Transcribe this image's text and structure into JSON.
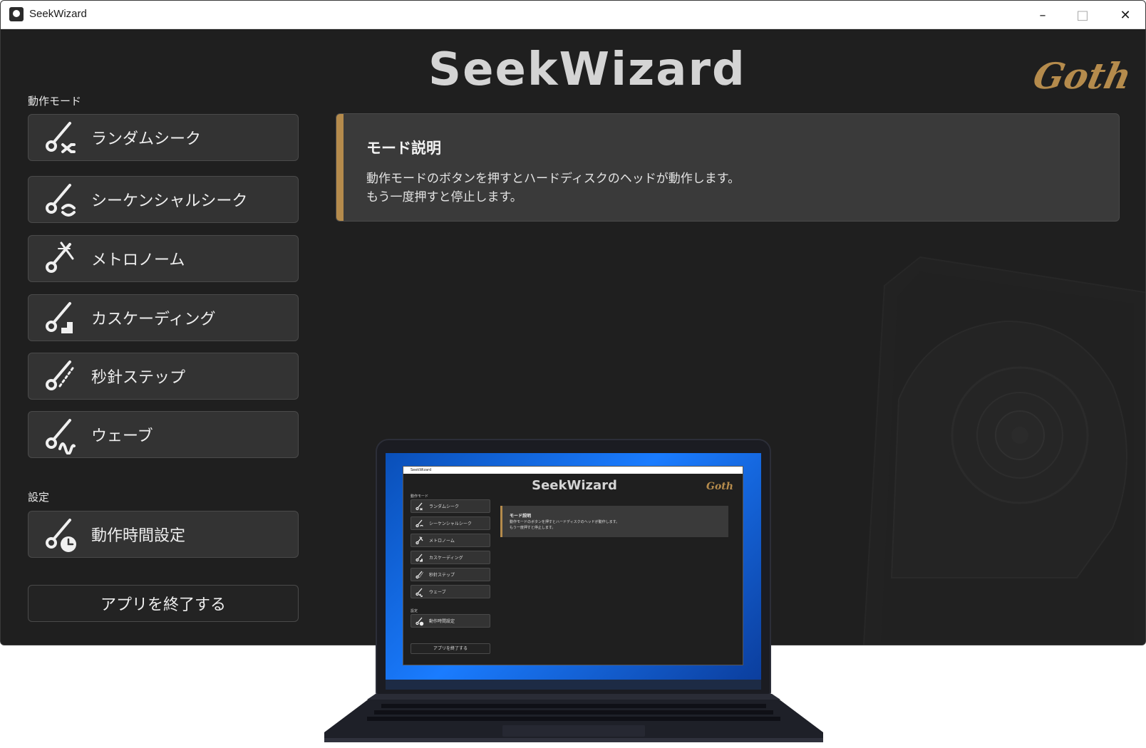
{
  "window": {
    "title": "SeekWizard",
    "controls": {
      "minimize": "–",
      "maximize": "□",
      "close": "✕"
    }
  },
  "header": {
    "brand": "SeekWizard",
    "logo": "Goth"
  },
  "sidebar": {
    "mode_section_label": "動作モード",
    "modes": [
      {
        "label": "ランダムシーク",
        "icon": "random-seek-icon"
      },
      {
        "label": "シーケンシャルシーク",
        "icon": "sequential-seek-icon"
      },
      {
        "label": "メトロノーム",
        "icon": "metronome-icon"
      },
      {
        "label": "カスケーディング",
        "icon": "cascading-icon"
      },
      {
        "label": "秒針ステップ",
        "icon": "second-hand-step-icon"
      },
      {
        "label": "ウェーブ",
        "icon": "wave-icon"
      }
    ],
    "settings_section_label": "設定",
    "settings": [
      {
        "label": "動作時間設定",
        "icon": "timer-icon"
      }
    ],
    "quit_label": "アプリを終了する"
  },
  "description": {
    "title": "モード説明",
    "line1": "動作モードのボタンを押すとハードディスクのヘッドが動作します。",
    "line2": "もう一度押すと停止します。"
  },
  "colors": {
    "accent": "#b58b4c",
    "background": "#1f1f1f",
    "button": "#333333"
  },
  "mockup": {
    "title": "SeekWizard",
    "brand": "SeekWizard",
    "logo": "Goth",
    "mode_section_label": "動作モード",
    "modes": [
      "ランダムシーク",
      "シーケンシャルシーク",
      "メトロノーム",
      "カスケーディング",
      "秒針ステップ",
      "ウェーブ"
    ],
    "settings_section_label": "設定",
    "settings": [
      "動作時間設定"
    ],
    "quit_label": "アプリを終了する",
    "desc_title": "モード説明",
    "desc_line1": "動作モードのボタンを押すとハードディスクのヘッドが動作します。",
    "desc_line2": "もう一度押すと停止します。"
  }
}
